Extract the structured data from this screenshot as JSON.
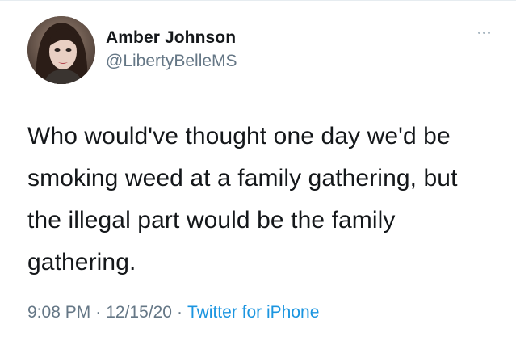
{
  "tweet": {
    "author": {
      "display_name": "Amber Johnson",
      "handle": "@LibertyBelleMS"
    },
    "text": "Who would've thought one day we'd be smoking weed at a family gathering, but the illegal part would be the family gathering.",
    "time": "9:08 PM",
    "separator": "·",
    "date": "12/15/20",
    "source": "Twitter for iPhone"
  },
  "colors": {
    "text": "#14171a",
    "secondary": "#657786",
    "link": "#1b95e0"
  },
  "icons": {
    "more": "more-horizontal-icon"
  }
}
